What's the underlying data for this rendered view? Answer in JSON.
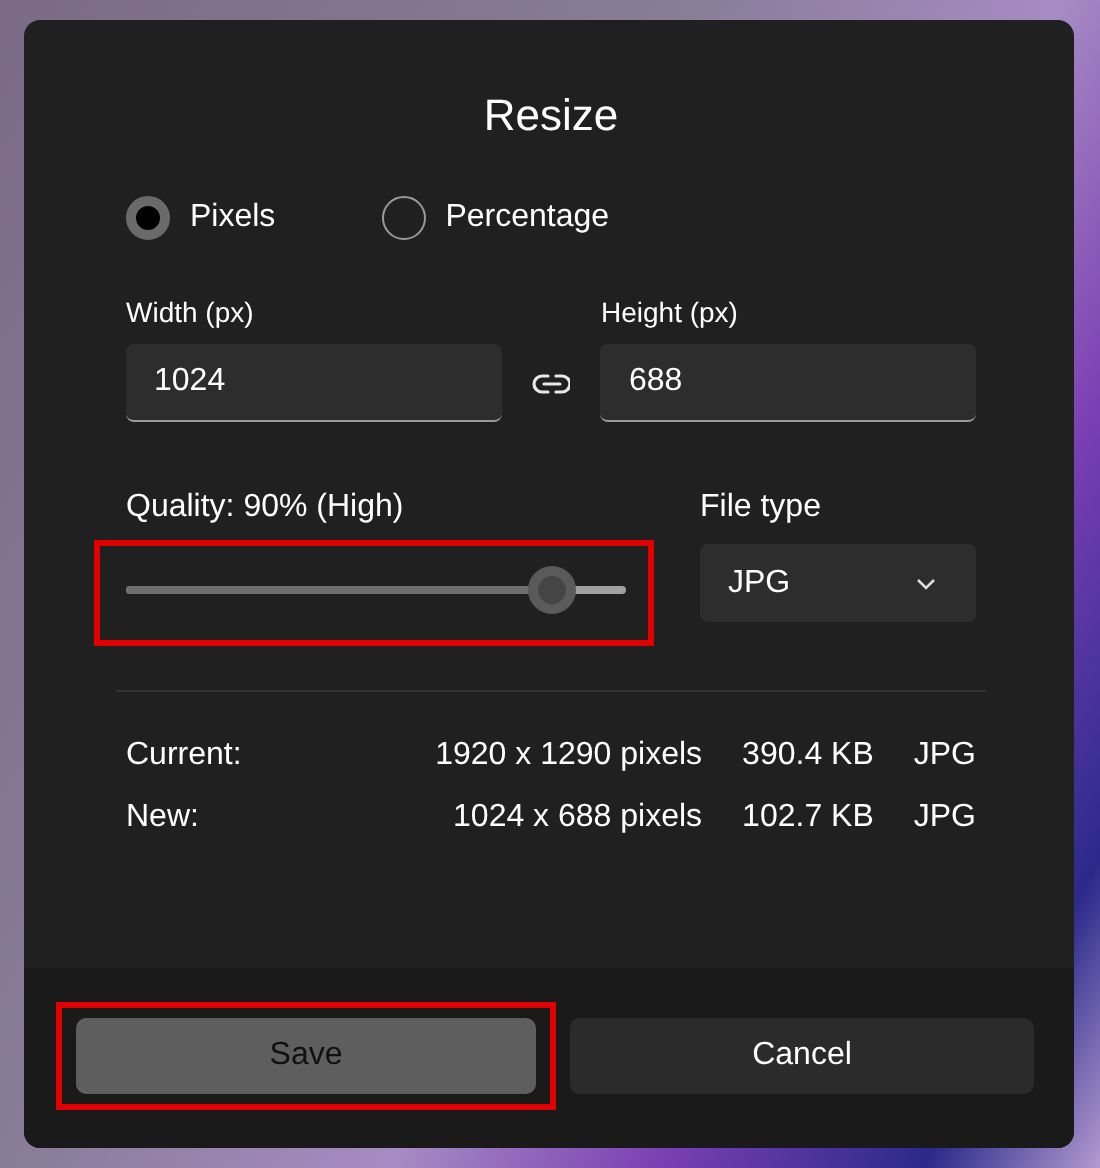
{
  "dialog": {
    "title": "Resize"
  },
  "size_modes": [
    {
      "label": "Pixels",
      "selected": true
    },
    {
      "label": "Percentage",
      "selected": false
    }
  ],
  "width": {
    "label": "Width (px)",
    "value": "1024"
  },
  "height": {
    "label": "Height (px)",
    "value": "688"
  },
  "quality": {
    "label": "Quality: 90% (High)",
    "level": 0.85,
    "highlighted": true
  },
  "file_type": {
    "label": "File type",
    "value": "JPG"
  },
  "info_rows": [
    {
      "label": "Current:",
      "dimensions": "1920 x 1290 pixels",
      "size": "390.4 KB",
      "type": "JPG"
    },
    {
      "label": "New:",
      "dimensions": "1024 x 688 pixels",
      "size": "102.7 KB",
      "type": "JPG"
    }
  ],
  "buttons": [
    {
      "label": "Save",
      "kind": "primary",
      "highlighted": true
    },
    {
      "label": "Cancel",
      "kind": "secondary",
      "highlighted": false
    }
  ]
}
